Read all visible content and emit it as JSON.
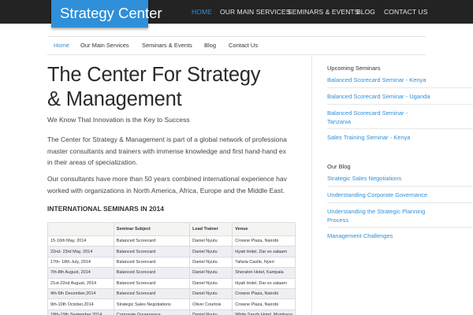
{
  "site": {
    "logo_text": "Strategy Center"
  },
  "top_nav": [
    "HOME",
    "OUR MAIN SERVICES",
    "SEMINARS & EVENTS",
    "BLOG",
    "CONTACT US"
  ],
  "sub_nav": [
    "Home",
    "Our Main Services",
    "Seminars & Events",
    "Blog",
    "Contact Us"
  ],
  "main": {
    "title_line1": "The Center For Strategy",
    "title_line2": "& Management",
    "tagline": "We Know That Innovation is the Key to Success",
    "para1": [
      "The Center for Strategy & Management is part of a global network of professiona",
      "master consultants and trainers with immense knowledge and first hand-hand ex",
      "in their areas of specialization."
    ],
    "para2": [
      "Our consultants have more than 50 years combined international experience hav",
      "worked with organizations in North America, Africa, Europe and the Middle East."
    ],
    "seminars_heading": "INTERNATIONAL SEMINARS IN 2014"
  },
  "seminar_table": {
    "headers": [
      "",
      "Seminar Subject",
      "Lead Trainer",
      "Venue"
    ],
    "rows": [
      [
        "15-16th May, 2014",
        "Balanced Scorecard",
        "Daniel Nyutu",
        "Crowne Plaza, Nairobi"
      ],
      [
        "22nd- 23rd May, 2014",
        "Balanced Scorecard",
        "Daniel Nyutu",
        "Hyatt Hotel, Dar es salaam"
      ],
      [
        "17th- 18th July, 2014",
        "Balanced Scorecard",
        "Daniel Nyutu",
        "Tafaria Castle, Nyeri"
      ],
      [
        "7th-8th August, 2014",
        "Balanced Scorecard",
        "Daniel Nyutu",
        "Sheraton Hotel, Kampala"
      ],
      [
        "21st-22nd August, 2014",
        "Balanced Scorecard",
        "Daniel Nyutu",
        "Hyatt Hotel, Dar es salaam"
      ],
      [
        "4th-5th December,2014",
        "Balanced Scorecard",
        "Daniel Nyutu",
        "Crowne Plaza, Nairobi"
      ],
      [
        "9th-10th October,2014",
        "Strategic Sales Negotiations",
        "Oliver Courtois",
        "Crowne Plaza, Nairobi"
      ],
      [
        "18th-19th September,2014",
        "Corporate Governance",
        "Daniel Nyutu",
        "White Sands Hotel, Mombasa"
      ]
    ]
  },
  "sidebar": {
    "upcoming_heading": "Upcoming Seminars",
    "upcoming": [
      [
        "Balanced Scorecard Seminar - Kenya"
      ],
      [
        "Balanced Scorecard Seminar - Uganda"
      ],
      [
        "Balanced Scorecard Seminar -",
        "Tanzania"
      ],
      [
        "Sales Training Seminar - Kenya"
      ]
    ],
    "blog_heading": "Our Blog",
    "blog": [
      [
        "Strategic Sales Negotiations"
      ],
      [
        "Understanding Corporate Governance"
      ],
      [
        "Understanding the Strategic Planning",
        "Process"
      ],
      [
        "Management Challenges"
      ]
    ]
  },
  "colors": {
    "accent": "#2f8fd8",
    "topbar": "#232323"
  }
}
